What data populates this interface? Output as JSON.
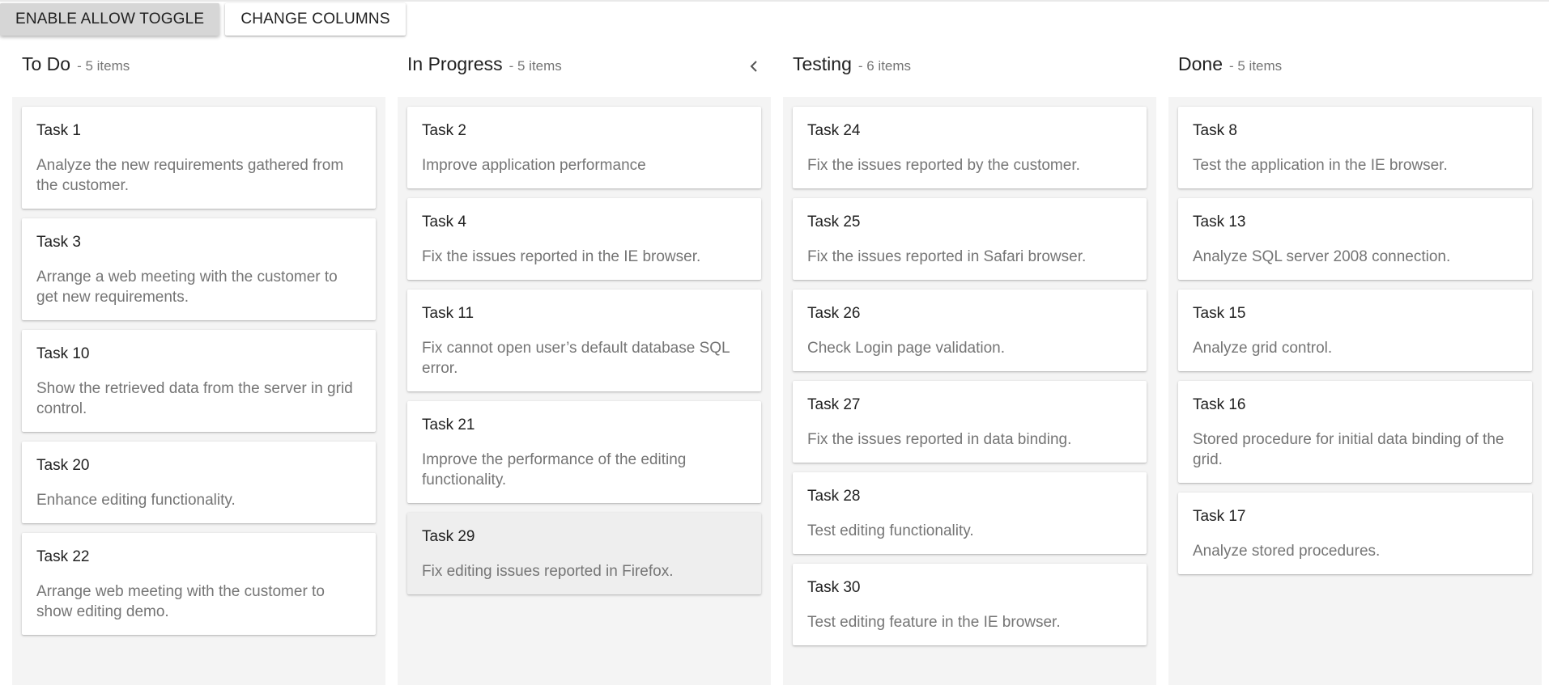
{
  "toolbar": {
    "enable_allow_toggle": "ENABLE ALLOW TOGGLE",
    "change_columns": "CHANGE COLUMNS"
  },
  "collapse_icon": "chevron-left-icon",
  "colors": {
    "column_bg": "#f4f4f4",
    "card_bg": "#ffffff",
    "selected_card_bg": "#eeeeee",
    "muted_text": "#757575"
  },
  "columns": [
    {
      "title": "To Do",
      "count": "- 5 items",
      "cards": [
        {
          "title": "Task 1",
          "desc": "Analyze the new requirements gathered from the customer."
        },
        {
          "title": "Task 3",
          "desc": "Arrange a web meeting with the customer to get new requirements."
        },
        {
          "title": "Task 10",
          "desc": "Show the retrieved data from the server in grid control."
        },
        {
          "title": "Task 20",
          "desc": "Enhance editing functionality."
        },
        {
          "title": "Task 22",
          "desc": "Arrange web meeting with the customer to show editing demo."
        }
      ]
    },
    {
      "title": "In Progress",
      "count": "- 5 items",
      "cards": [
        {
          "title": "Task 2",
          "desc": "Improve application performance"
        },
        {
          "title": "Task 4",
          "desc": "Fix the issues reported in the IE browser."
        },
        {
          "title": "Task 11",
          "desc": "Fix cannot open user’s default database SQL error."
        },
        {
          "title": "Task 21",
          "desc": "Improve the performance of the editing functionality."
        },
        {
          "title": "Task 29",
          "desc": "Fix editing issues reported in Firefox.",
          "selected": true
        }
      ]
    },
    {
      "title": "Testing",
      "count": "- 6 items",
      "cards": [
        {
          "title": "Task 24",
          "desc": "Fix the issues reported by the customer."
        },
        {
          "title": "Task 25",
          "desc": "Fix the issues reported in Safari browser."
        },
        {
          "title": "Task 26",
          "desc": "Check Login page validation."
        },
        {
          "title": "Task 27",
          "desc": "Fix the issues reported in data binding."
        },
        {
          "title": "Task 28",
          "desc": "Test editing functionality."
        },
        {
          "title": "Task 30",
          "desc": "Test editing feature in the IE browser."
        }
      ]
    },
    {
      "title": "Done",
      "count": "- 5 items",
      "cards": [
        {
          "title": "Task 8",
          "desc": "Test the application in the IE browser."
        },
        {
          "title": "Task 13",
          "desc": "Analyze SQL server 2008 connection."
        },
        {
          "title": "Task 15",
          "desc": "Analyze grid control."
        },
        {
          "title": "Task 16",
          "desc": "Stored procedure for initial data binding of the grid."
        },
        {
          "title": "Task 17",
          "desc": "Analyze stored procedures."
        }
      ]
    }
  ]
}
